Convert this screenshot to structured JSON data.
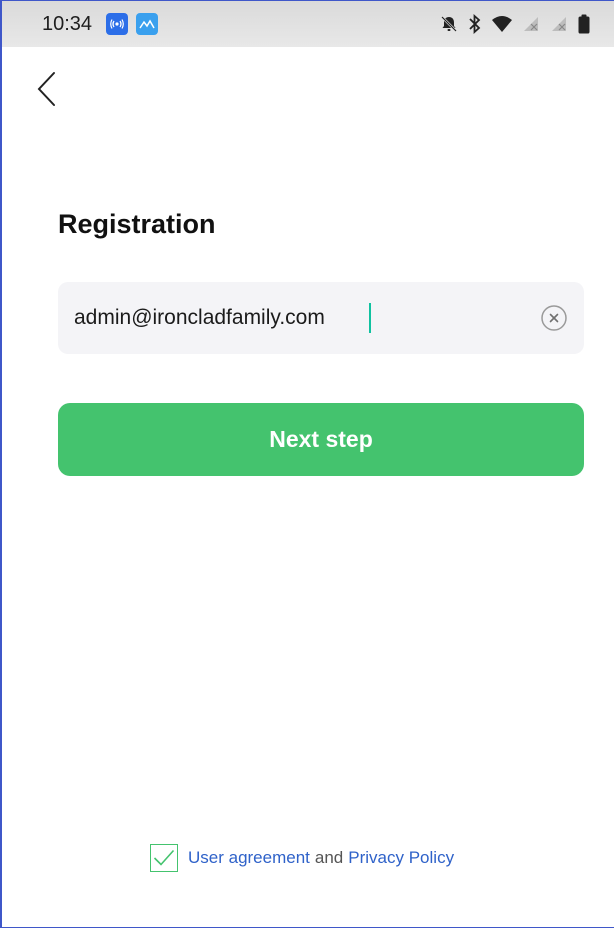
{
  "status_bar": {
    "time": "10:34"
  },
  "page": {
    "title": "Registration"
  },
  "email_field": {
    "value": "admin@ironcladfamily.com"
  },
  "next_button": {
    "label": "Next step"
  },
  "agreement": {
    "checked": true,
    "user_agreement_label": "User agreement",
    "and_label": "and",
    "privacy_policy_label": "Privacy Policy"
  },
  "colors": {
    "accent_green": "#44c36e",
    "link_blue": "#2f62c9",
    "input_bg": "#f4f4f7"
  },
  "icons": {
    "back": "chevron-left-icon",
    "clear": "clear-circle-icon",
    "check": "checkmark-icon"
  }
}
